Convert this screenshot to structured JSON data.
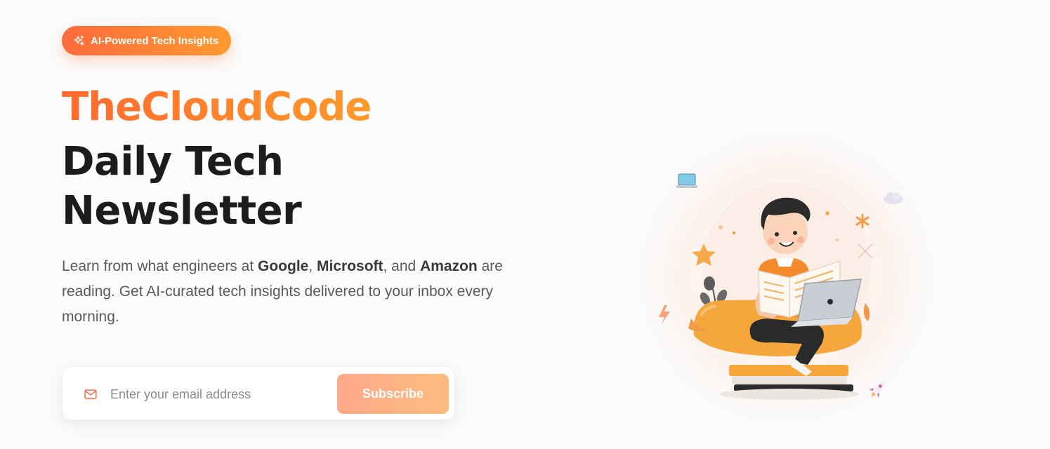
{
  "badge": {
    "label": "AI-Powered Tech Insights",
    "icon": "sparkle-icon"
  },
  "hero": {
    "brand": "TheCloudCode",
    "headline_line1": "Daily Tech",
    "headline_line2": "Newsletter",
    "description": {
      "prefix": "Learn from what engineers at ",
      "company1": "Google",
      "sep1": ", ",
      "company2": "Microsoft",
      "sep2": ", and ",
      "company3": "Amazon",
      "suffix": " are reading. Get AI-curated tech insights delivered to your inbox every morning."
    }
  },
  "signup": {
    "email_placeholder": "Enter your email address",
    "email_value": "",
    "email_icon": "mail-icon",
    "subscribe_label": "Subscribe"
  },
  "illustration": {
    "subject": "person-reading-newsletter-with-laptop",
    "floating_icons": [
      "laptop-icon",
      "cloud-icon",
      "rocket-icon",
      "lightning-icon"
    ]
  },
  "colors": {
    "accent_start": "#ff6a2f",
    "accent_end": "#ff9a2a",
    "headline": "#1c1c1c",
    "body_text": "#5a5a5a",
    "background": "#fbfbfb"
  }
}
